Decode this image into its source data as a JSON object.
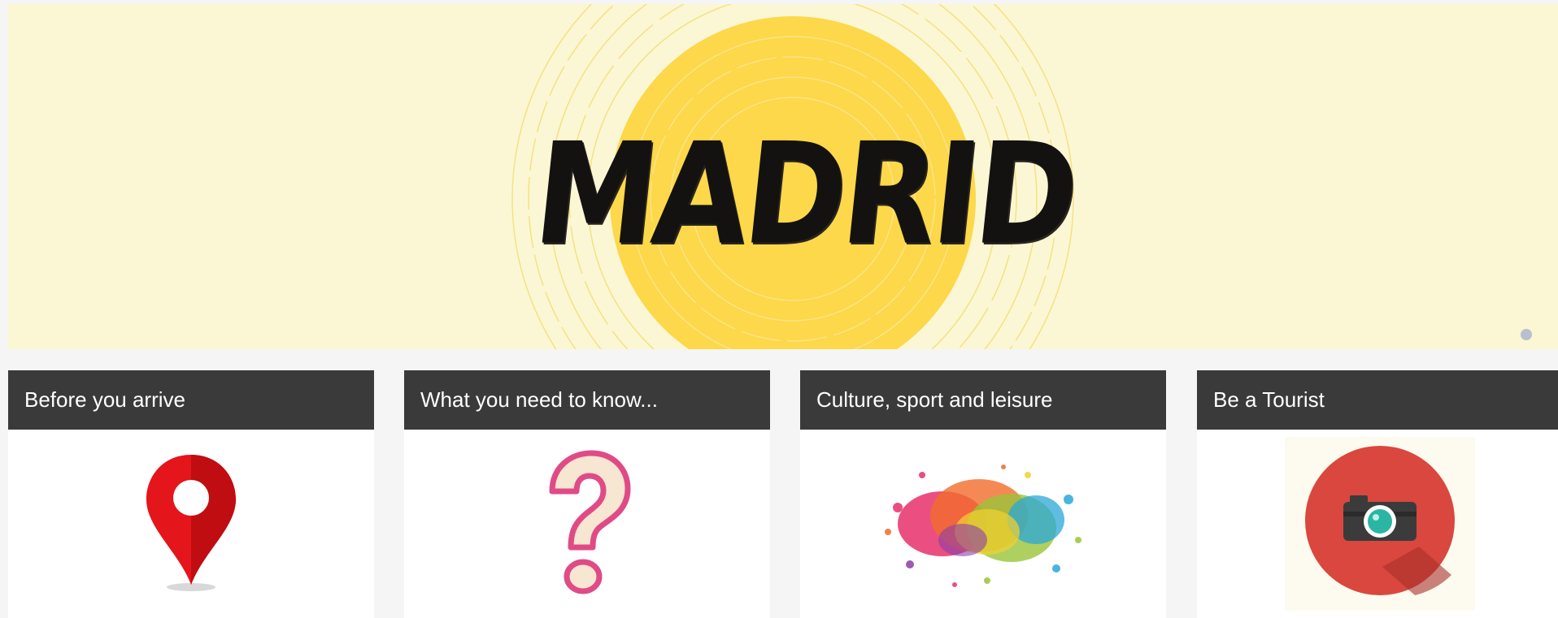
{
  "hero": {
    "title": "MADRID",
    "background_color": "#fbf7d4",
    "sun_color": "#fcd84a",
    "active_slide_dot_color": "#b8c0d0"
  },
  "cards": [
    {
      "title": "Before you arrive",
      "icon": "location-pin-icon",
      "icon_color": "#e4151b"
    },
    {
      "title": "What you need to know...",
      "icon": "question-mark-icon",
      "icon_color": "#e04b86"
    },
    {
      "title": "Culture, sport and leisure",
      "icon": "color-splash-icon"
    },
    {
      "title": "Be a Tourist",
      "icon": "camera-icon",
      "icon_color": "#d9473f"
    }
  ],
  "colors": {
    "card_header": "#3a3a3a",
    "card_header_text": "#ffffff",
    "page_background": "#f5f5f5"
  }
}
